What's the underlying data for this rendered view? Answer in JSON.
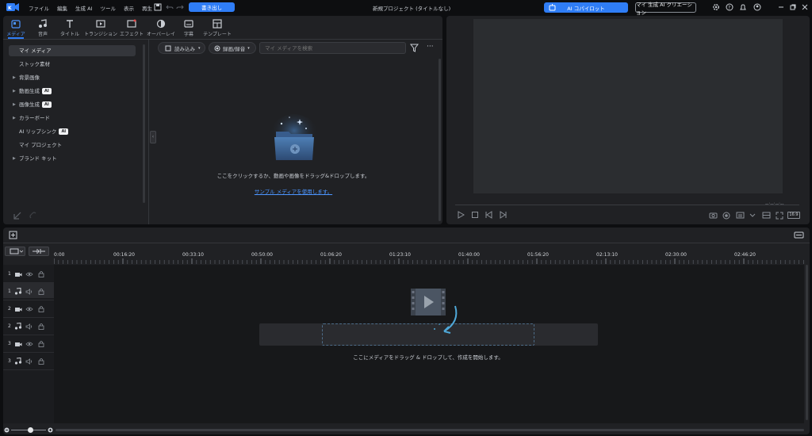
{
  "titlebar": {
    "menus": [
      "ファイル",
      "編集",
      "生成 AI",
      "ツール",
      "表示",
      "再生"
    ],
    "export_label": "書き出し",
    "project_title": "新規プロジェクト (タイトルなし)",
    "ai_copilot_label": "AI コパイロット",
    "my_ai_creation_label": "マイ 生成 AI クリエーション"
  },
  "media_tabs": [
    "メディア",
    "音声",
    "タイトル",
    "トランジション",
    "エフェクト",
    "オーバーレイ",
    "字幕",
    "テンプレート"
  ],
  "sidebar": {
    "items": [
      {
        "label": "マイ メディア",
        "arrow": false,
        "ai": false,
        "selected": true
      },
      {
        "label": "ストック素材",
        "arrow": false,
        "ai": false
      },
      {
        "label": "背景画像",
        "arrow": true,
        "ai": false
      },
      {
        "label": "動画生成",
        "arrow": true,
        "ai": true
      },
      {
        "label": "画像生成",
        "arrow": true,
        "ai": true
      },
      {
        "label": "カラーボード",
        "arrow": true,
        "ai": false
      },
      {
        "label": "AI リップシンク",
        "arrow": false,
        "ai": true
      },
      {
        "label": "マイ プロジェクト",
        "arrow": false,
        "ai": false
      },
      {
        "label": "ブランド キット",
        "arrow": true,
        "ai": false
      }
    ],
    "ai_badge": "AI"
  },
  "media_toolbar": {
    "import_label": "読み込み",
    "record_label": "録画/録音",
    "search_placeholder": "マイ メディアを検索"
  },
  "media_empty": {
    "hint": "ここをクリックするか、動画や画像をドラッグ&ドロップします。",
    "sample_link": "サンプル メディアを使用します。"
  },
  "preview": {
    "timecode": "--:--:--:--",
    "aspect": "16:9"
  },
  "timeline": {
    "ruler": [
      "0:00",
      "00:16:20",
      "00:33:10",
      "00:50:00",
      "01:06:20",
      "01:23:10",
      "01:40:00",
      "01:56:20",
      "02:13:10",
      "02:30:00",
      "02:46:20"
    ],
    "tracks": [
      {
        "num": "1",
        "type": "video"
      },
      {
        "num": "1",
        "type": "audio"
      },
      {
        "num": "2",
        "type": "video"
      },
      {
        "num": "2",
        "type": "audio"
      },
      {
        "num": "3",
        "type": "video"
      },
      {
        "num": "3",
        "type": "audio"
      }
    ],
    "drop_hint": "ここにメディアをドラッグ & ドロップして、作成を開始します。"
  },
  "colors": {
    "accent": "#2f7df6",
    "panel": "#202124",
    "background": "#0d0e10"
  }
}
